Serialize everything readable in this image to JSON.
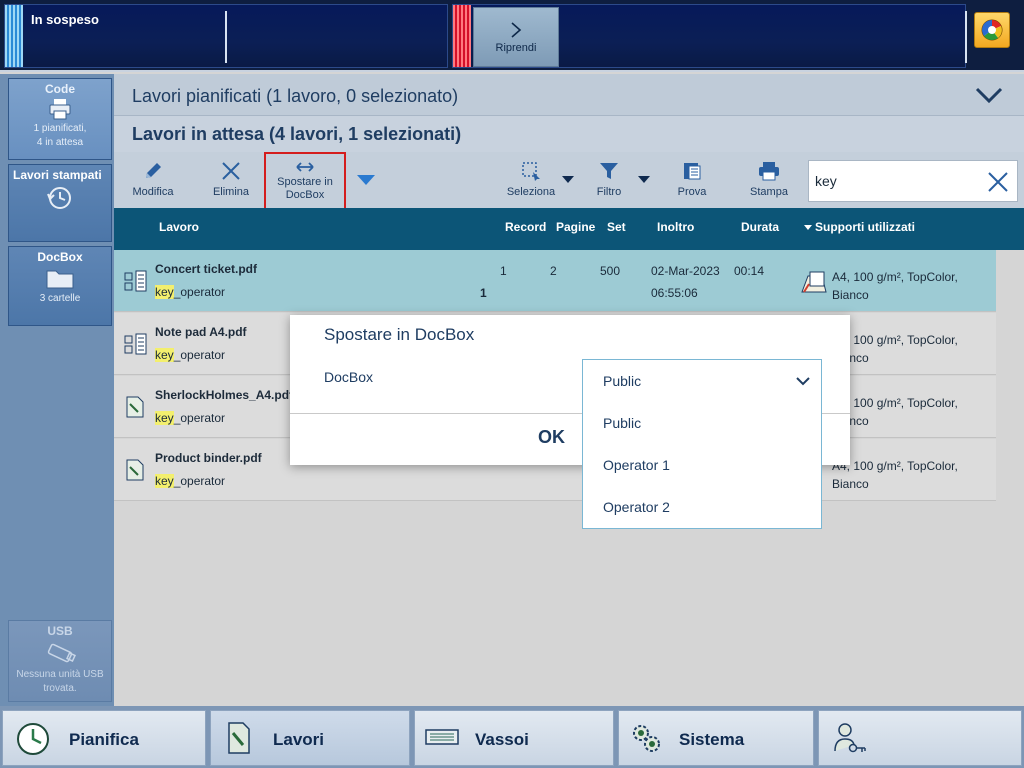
{
  "topbar": {
    "status_text": "In sospeso",
    "resume_label": "Riprendi",
    "status_icon": "system-status-icon"
  },
  "sidebar": {
    "queues": {
      "title": "Code",
      "line1": "1 pianificati,",
      "line2": "4 in attesa"
    },
    "printed": {
      "title": "Lavori stampati"
    },
    "docbox": {
      "title": "DocBox",
      "sub": "3 cartelle"
    },
    "usb": {
      "title": "USB",
      "line1": "Nessuna unità USB",
      "line2": "trovata."
    }
  },
  "main": {
    "planned_title": "Lavori pianificati (1 lavoro, 0 selezionato)",
    "waiting_title": "Lavori in attesa (4 lavori, 1 selezionati)"
  },
  "toolbar": {
    "edit": "Modifica",
    "delete": "Elimina",
    "move_line1": "Spostare in",
    "move_line2": "DocBox",
    "select": "Seleziona",
    "filter": "Filtro",
    "proof": "Prova",
    "print": "Stampa",
    "search_value": "key"
  },
  "table": {
    "headers": {
      "job": "Lavoro",
      "records": "Record",
      "pages": "Pagine",
      "sets": "Set",
      "submitted": "Inoltro",
      "duration": "Durata",
      "media": "Supporti utilizzati"
    },
    "rows": [
      {
        "name": "Concert ticket.pdf",
        "owner_highlight": "key",
        "owner_rest": "_operator",
        "records": "1",
        "pages": "2",
        "sets": "500",
        "date": "02-Mar-2023",
        "time": "06:55:06",
        "duration": "00:14",
        "copies": "1",
        "media_line1": "A4, 100 g/m², TopColor,",
        "media_line2": "Bianco"
      },
      {
        "name": "Note pad A4.pdf",
        "owner_highlight": "key",
        "owner_rest": "_operator",
        "media_line1": "A4, 100 g/m², TopColor,",
        "media_line2": "Bianco"
      },
      {
        "name": "SherlockHolmes_A4.pdf",
        "owner_highlight": "key",
        "owner_rest": "_operator",
        "media_line1": "A4, 100 g/m², TopColor,",
        "media_line2": "Bianco"
      },
      {
        "name": "Product binder.pdf",
        "owner_highlight": "key",
        "owner_rest": "_operator",
        "media_line1": "A4, 100 g/m², TopColor,",
        "media_line2": "Bianco"
      }
    ]
  },
  "dialog": {
    "title": "Spostare in DocBox",
    "field_label": "DocBox",
    "ok_label": "OK",
    "dropdown": {
      "selected": "Public",
      "options": [
        "Public",
        "Operator 1",
        "Operator 2"
      ]
    }
  },
  "bottom_nav": {
    "plan": "Pianifica",
    "jobs": "Lavori",
    "trays": "Vassoi",
    "system": "Sistema"
  },
  "colors": {
    "accent": "#0c5577",
    "selected_row": "#9dcbd4",
    "highlight": "#f3ef6e",
    "move_button_border": "#d41d1d"
  }
}
